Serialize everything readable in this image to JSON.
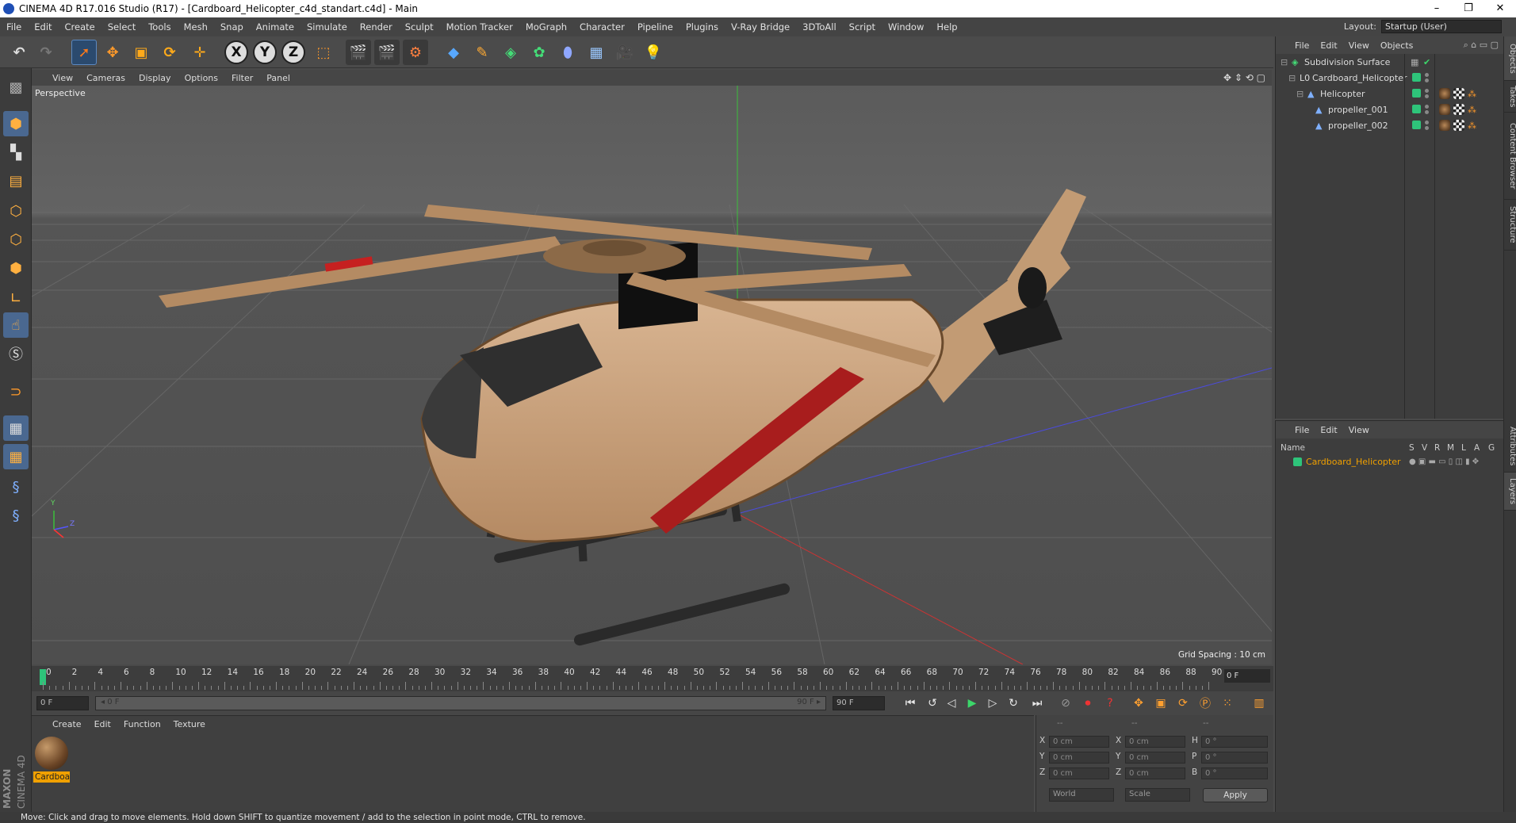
{
  "window": {
    "title": "CINEMA 4D R17.016 Studio (R17) - [Cardboard_Helicopter_c4d_standart.c4d] - Main",
    "controls": [
      "–",
      "❐",
      "✕"
    ]
  },
  "menubar": {
    "items": [
      "File",
      "Edit",
      "Create",
      "Select",
      "Tools",
      "Mesh",
      "Snap",
      "Animate",
      "Simulate",
      "Render",
      "Sculpt",
      "Motion Tracker",
      "MoGraph",
      "Character",
      "Pipeline",
      "Plugins",
      "V-Ray Bridge",
      "3DToAll",
      "Script",
      "Window",
      "Help"
    ],
    "layout_label": "Layout:",
    "layout_value": "Startup (User)"
  },
  "toolbar": {
    "axis_x": "X",
    "axis_y": "Y",
    "axis_z": "Z"
  },
  "viewport": {
    "menu": [
      "View",
      "Cameras",
      "Display",
      "Options",
      "Filter",
      "Panel"
    ],
    "label": "Perspective",
    "grid_spacing": "Grid Spacing : 10 cm",
    "gizmo_y": "Y",
    "gizmo_z": "Z"
  },
  "timeline": {
    "ticks": [
      "0",
      "2",
      "4",
      "6",
      "8",
      "10",
      "12",
      "14",
      "16",
      "18",
      "20",
      "22",
      "24",
      "26",
      "28",
      "30",
      "32",
      "34",
      "36",
      "38",
      "40",
      "42",
      "44",
      "46",
      "48",
      "50",
      "52",
      "54",
      "56",
      "58",
      "60",
      "62",
      "64",
      "66",
      "68",
      "70",
      "72",
      "74",
      "76",
      "78",
      "80",
      "82",
      "84",
      "86",
      "88",
      "90"
    ],
    "current_frame": "0 F"
  },
  "transport": {
    "start": "0 F",
    "range_start": "◂ 0 F",
    "range_end": "90 F ▸",
    "end": "90 F"
  },
  "materials": {
    "menu": [
      "Create",
      "Edit",
      "Function",
      "Texture"
    ],
    "items": [
      {
        "name": "Cardboa"
      }
    ]
  },
  "coords": {
    "headers": [
      "--",
      "--",
      "--"
    ],
    "rows": [
      {
        "axis": "X",
        "pos": "0 cm",
        "size_axis": "X",
        "size": "0 cm",
        "rot_axis": "H",
        "rot": "0 °"
      },
      {
        "axis": "Y",
        "pos": "0 cm",
        "size_axis": "Y",
        "size": "0 cm",
        "rot_axis": "P",
        "rot": "0 °"
      },
      {
        "axis": "Z",
        "pos": "0 cm",
        "size_axis": "Z",
        "size": "0 cm",
        "rot_axis": "B",
        "rot": "0 °"
      }
    ],
    "mode_world": "World",
    "mode_scale": "Scale",
    "apply": "Apply"
  },
  "objects_panel": {
    "menu": [
      "File",
      "Edit",
      "View",
      "Objects"
    ],
    "items": [
      {
        "name": "Subdivision Surface",
        "indent": 0
      },
      {
        "name": "Cardboard_Helicopter",
        "indent": 1
      },
      {
        "name": "Helicopter",
        "indent": 2
      },
      {
        "name": "propeller_001",
        "indent": 3
      },
      {
        "name": "propeller_002",
        "indent": 3
      }
    ]
  },
  "layers_panel": {
    "menu": [
      "File",
      "Edit",
      "View"
    ],
    "col_name": "Name",
    "cols": [
      "S",
      "V",
      "R",
      "M",
      "L",
      "A",
      "G"
    ],
    "items": [
      {
        "name": "Cardboard_Helicopter"
      }
    ]
  },
  "right_tabs": [
    "Objects",
    "Takes",
    "Content Browser",
    "Structure",
    "Attributes",
    "Layers"
  ],
  "branding": {
    "line1": "MAXON",
    "line2": "CINEMA 4D"
  },
  "status": "Move: Click and drag to move elements. Hold down SHIFT to quantize movement / add to the selection in point mode, CTRL to remove.",
  "colors": {
    "accent_green": "#2ec47a",
    "selection_orange": "#f0a000",
    "highlight_blue": "#4a6890"
  }
}
